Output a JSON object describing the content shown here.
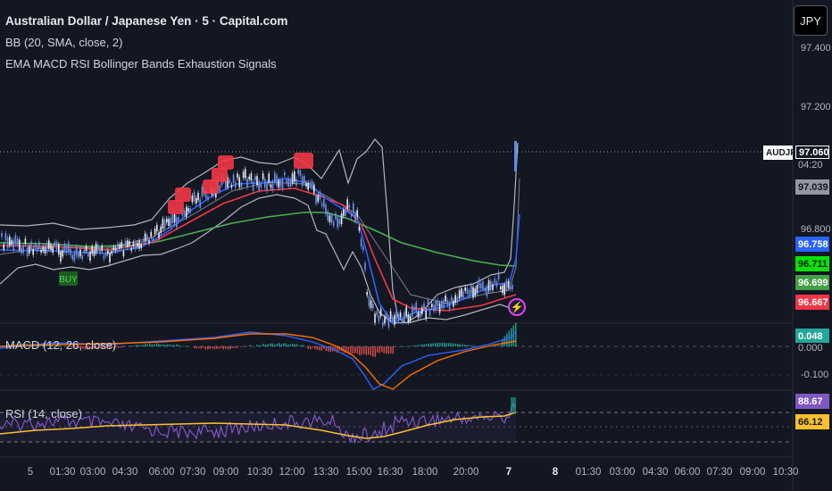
{
  "header": {
    "symbol_title": "Australian Dollar / Japanese Yen · 5 · Capital.com",
    "bb_legend": "BB (20, SMA, close, 2)",
    "indicator_legend": "EMA MACD RSI Bollinger Bands Exhaustion Signals"
  },
  "currency_button": "JPY",
  "price_axis": [
    "97.400",
    "97.200",
    "96.800",
    "-0.100"
  ],
  "price_tags": {
    "symbol": "AUDJPY",
    "last": "97.060",
    "countdown": "04:20",
    "p1": "97.039",
    "p2": "96.758",
    "p3": "96.711",
    "p4": "96.699",
    "p5": "96.667",
    "macd_value": "0.048",
    "macd_zero": "0.000",
    "rsi1": "88.67",
    "rsi2": "66.12"
  },
  "panes": {
    "macd_label": "MACD (12, 26, close)",
    "rsi_label": "RSI (14, close)"
  },
  "signals": {
    "buy_label": "BUY"
  },
  "time_axis": [
    "5",
    "01:30",
    "03:00",
    "04:30",
    "06:00",
    "07:30",
    "09:00",
    "10:30",
    "12:00",
    "13:30",
    "15:00",
    "16:30",
    "18:00",
    "20:00",
    "7",
    "8",
    "01:30",
    "03:00",
    "04:30",
    "06:00",
    "07:30",
    "09:00",
    "10:30"
  ],
  "colors": {
    "background": "#131722",
    "up_candle": "#5b8def",
    "bb": "#b2b5be",
    "ema_fast": "#2962ff",
    "ema_mid": "#f23645",
    "ema_slow": "#4caf50",
    "macd": "#2962ff",
    "signal": "#ff6d00",
    "hist_up": "#26a69a",
    "hist_down": "#ef5350",
    "rsi": "#7e57c2",
    "rsi_ma": "#fbc02d"
  }
}
